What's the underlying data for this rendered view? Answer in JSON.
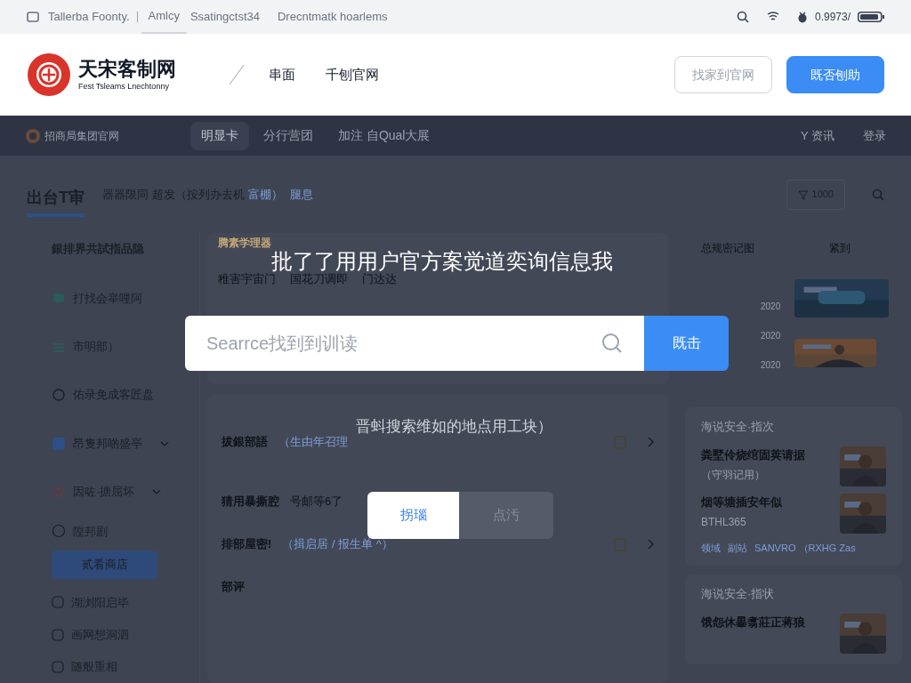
{
  "status_bar": {
    "left": [
      "Tallerba Foonty.",
      "Amlcy",
      "Ssatingctst34",
      "Drecntmatk hoarlems"
    ],
    "battery": "0.9973/"
  },
  "header": {
    "logo_title": "天宋客制网",
    "logo_subtitle": "Fest Tsleams Lnechtonny",
    "nav": [
      "串面",
      "千刨官网"
    ],
    "buttons": [
      {
        "label": "找家到官网",
        "kind": "outline"
      },
      {
        "label": "既否刨助",
        "kind": "primary"
      }
    ]
  },
  "top_nav": {
    "brand": "招商局集团官网",
    "items": [
      {
        "label": "明显卡",
        "selected": true
      },
      {
        "label": "分行营团",
        "selected": false
      },
      {
        "label": "加注 自Qual大展",
        "selected": false
      }
    ],
    "right": [
      "Y 资讯",
      "登录"
    ]
  },
  "section": {
    "title": "出台T审",
    "subtitle": "器器限同  超发（按列办去机",
    "link": "富棚）",
    "extra": "腿息",
    "count": "1000"
  },
  "sidebar": {
    "heading": "銀排界共試指品隐",
    "items": [
      {
        "label": "打找会举哩阿",
        "expandable": false
      },
      {
        "label": "市明部）",
        "expandable": false
      },
      {
        "label": "佑录免成客匠盘",
        "expandable": false
      },
      {
        "label": "昂隻邦啲盛亭",
        "expandable": true
      },
      {
        "label": "因咗·搪屈坏",
        "expandable": true
      },
      {
        "label": "隍邦剧",
        "expandable": false
      }
    ],
    "button": "贰看商店",
    "more": [
      "湖浏阳启毕",
      "画网想洞泗",
      "随般重相"
    ]
  },
  "main": {
    "heading": "腾素学理器",
    "tags": [
      "稚害宇宙门",
      "国花刀调即",
      "门达达"
    ],
    "rows": [
      {
        "title": "拔銀部語",
        "note": "（生由年召理"
      },
      {
        "title": "猜用暴撕腔",
        "note": "号邮等6了"
      },
      {
        "title": "排部屋密!",
        "note": "（揖启居 / 报生单 ^）"
      },
      {
        "title": "部评"
      }
    ]
  },
  "right": {
    "header": [
      "总规密记图",
      "紧到"
    ],
    "dates": [
      "2020",
      "2020",
      "2020"
    ],
    "cards": [
      {
        "title": "海说安全·指次",
        "items": [
          {
            "title": "粪墅伶烧绾固荚请据",
            "sub": "（守羽记用）"
          },
          {
            "title": "烟等塘插安年似",
            "sub": "BTHL365"
          }
        ],
        "links": [
          "领域",
          "副站",
          "SANVRO （RXHG Zas"
        ]
      },
      {
        "title": "海说安全·指状",
        "items": [
          {
            "title": "饿怨休曓翥莊正蒋狼"
          }
        ]
      }
    ]
  },
  "modal": {
    "title": "批了了用用户官方案觉道奕询信息我",
    "placeholder": "Searrce找到到训读",
    "search_button": "既击",
    "hint": "晋蚪搜索维如的地点用工块）",
    "options": [
      {
        "label": "拐瑙",
        "selected": true
      },
      {
        "label": "点汚",
        "selected": false
      }
    ]
  }
}
